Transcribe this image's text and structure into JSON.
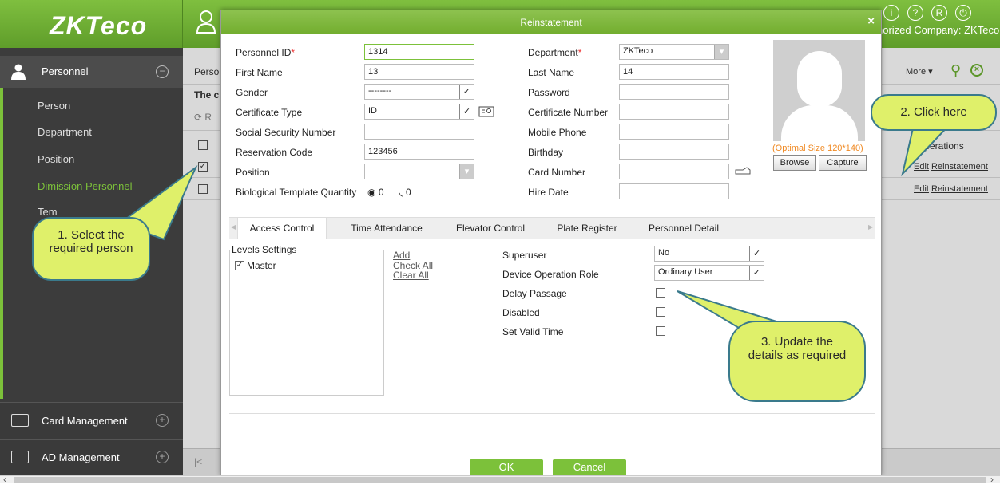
{
  "app": {
    "logo": "ZKTeco",
    "authorized_company": "horized Company: ZKTeco",
    "header_icons": [
      "info-icon",
      "help-icon",
      "user-circle-icon",
      "power-icon"
    ]
  },
  "sidebar": {
    "section": "Personnel",
    "items": [
      {
        "label": "Person"
      },
      {
        "label": "Department"
      },
      {
        "label": "Position"
      },
      {
        "label": "Dimission Personnel"
      },
      {
        "label": "Tem"
      }
    ],
    "footer": [
      {
        "label": "Card Management"
      },
      {
        "label": "AD Management"
      }
    ]
  },
  "background": {
    "crumb": "Persor",
    "subtitle": "The cu",
    "refresh_label": "R",
    "operations_header": "Operations",
    "more_label": "More",
    "row_actions": [
      {
        "edit": "Edit",
        "reinstate": "Reinstatement"
      },
      {
        "edit": "Edit",
        "reinstate": "Reinstatement"
      }
    ]
  },
  "modal": {
    "title": "Reinstatement",
    "close": "×",
    "left_fields": {
      "personnel_id_label": "Personnel ID",
      "personnel_id_value": "1314",
      "first_name_label": "First Name",
      "first_name_value": "13",
      "gender_label": "Gender",
      "gender_value": "--------",
      "certificate_type_label": "Certificate Type",
      "certificate_type_value": "ID",
      "ssn_label": "Social Security Number",
      "reservation_code_label": "Reservation Code",
      "reservation_code_value": "123456",
      "position_label": "Position",
      "bio_label": "Biological Template Quantity",
      "fingerprint_count": "0",
      "finger_vein_count": "0"
    },
    "right_fields": {
      "department_label": "Department",
      "department_value": "ZKTeco",
      "last_name_label": "Last Name",
      "last_name_value": "14",
      "password_label": "Password",
      "certificate_number_label": "Certificate Number",
      "mobile_phone_label": "Mobile Phone",
      "birthday_label": "Birthday",
      "card_number_label": "Card Number",
      "hire_date_label": "Hire Date"
    },
    "photo": {
      "optimal_size": "(Optimal Size 120*140)",
      "browse": "Browse",
      "capture": "Capture"
    },
    "tabs": [
      "Access Control",
      "Time Attendance",
      "Elevator Control",
      "Plate Register",
      "Personnel Detail"
    ],
    "access": {
      "levels_settings": "Levels Settings",
      "level_master": "Master",
      "add": "Add",
      "check_all": "Check All",
      "clear_all": "Clear All",
      "superuser_label": "Superuser",
      "superuser_value": "No",
      "device_role_label": "Device Operation Role",
      "device_role_value": "Ordinary User",
      "delay_passage_label": "Delay Passage",
      "disabled_label": "Disabled",
      "valid_time_label": "Set Valid Time"
    },
    "ok": "OK",
    "cancel": "Cancel"
  },
  "callouts": {
    "one": "1. Select the required person",
    "two": "2. Click here",
    "three": "3. Update the details as required"
  }
}
